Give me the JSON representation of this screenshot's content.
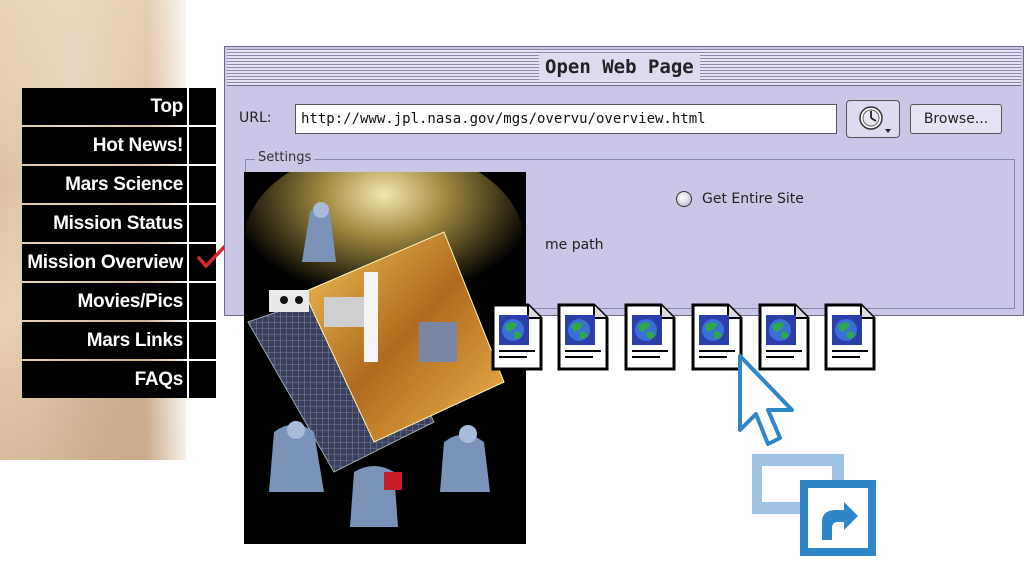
{
  "nav": {
    "items": [
      {
        "label": "Top"
      },
      {
        "label": "Hot News!"
      },
      {
        "label": "Mars Science"
      },
      {
        "label": "Mission Status"
      },
      {
        "label": "Mission Overview",
        "checked": true
      },
      {
        "label": "Movies/Pics"
      },
      {
        "label": "Mars Links"
      },
      {
        "label": "FAQs"
      }
    ],
    "check_color": "#d9242b"
  },
  "dialog": {
    "title": "Open Web Page",
    "url_label": "URL:",
    "url_value": "http://www.jpl.nasa.gov/mgs/overvu/overview.html",
    "clock_icon": "clock-icon",
    "browse_label": "Browse...",
    "settings_label": "Settings",
    "radio_get_entire_site": "Get Entire Site",
    "path_text": "me path",
    "background_color": "#c9c6e6"
  },
  "photo": {
    "description_icon": "spacecraft-photo"
  },
  "document_icons": [
    {
      "icon": "web-document-icon"
    },
    {
      "icon": "web-document-icon"
    },
    {
      "icon": "web-document-icon"
    },
    {
      "icon": "web-document-icon"
    },
    {
      "icon": "web-document-icon"
    },
    {
      "icon": "web-document-icon"
    }
  ],
  "cursor": {
    "icon": "arrow-cursor-icon"
  },
  "shortcut": {
    "icon": "shortcut-copy-icon",
    "accent": "#2f86c8"
  }
}
